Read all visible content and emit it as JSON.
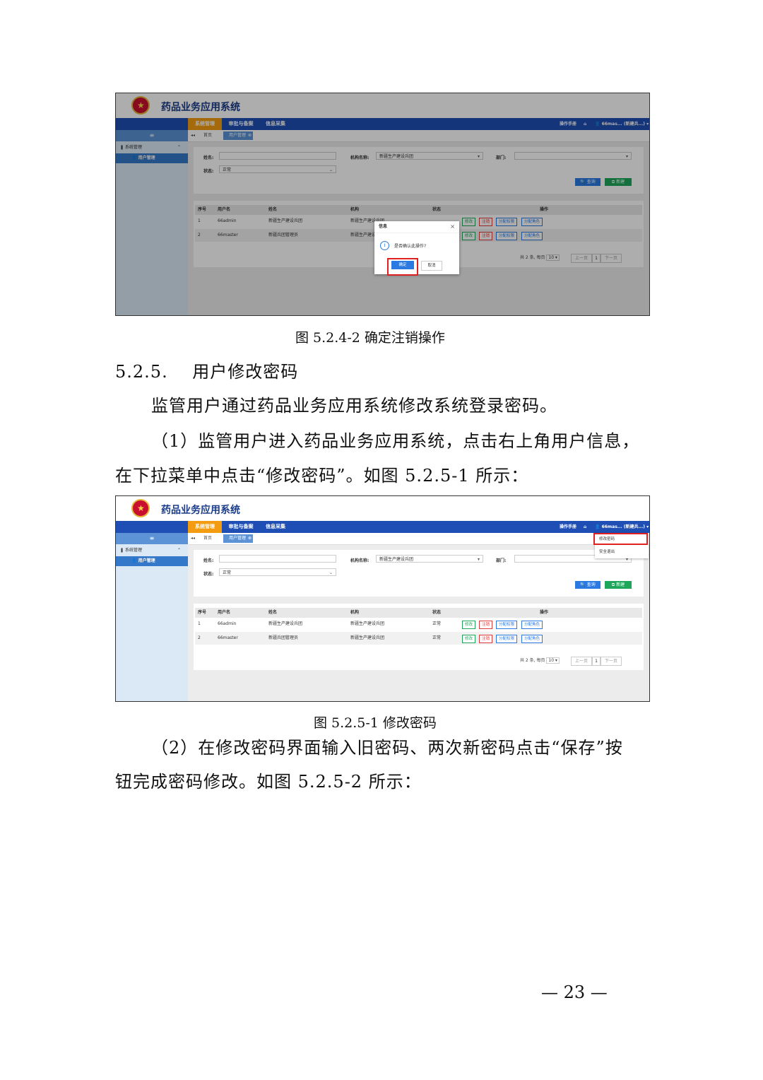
{
  "app": {
    "title": "药品业务应用系统",
    "nav": [
      "系统管理",
      "审批与备案",
      "信息采集"
    ],
    "nav_right": {
      "manual": "操作手册",
      "home_icon": "home-icon",
      "user": "66mas... (新建兵...) ▾"
    },
    "sidebar": {
      "toggle": "≡",
      "group": "系统管理",
      "item": "用户管理"
    },
    "tabs": {
      "home": "首页",
      "active": "用户管理"
    },
    "search": {
      "name_label": "姓名:",
      "org_label": "机构名称:",
      "org_value": "新疆生产建设兵团",
      "dept_label": "部门:",
      "status_label": "状态:",
      "status_value": "正常",
      "query_button": "查询",
      "new_button": "新建"
    },
    "table": {
      "headers": [
        "序号",
        "用户名",
        "姓名",
        "机构",
        "状态",
        "操作"
      ],
      "rows": [
        {
          "no": "1",
          "username": "66admin",
          "name": "新疆生产建设兵团",
          "org": "新疆生产建设兵团",
          "status": "正常"
        },
        {
          "no": "2",
          "username": "66master",
          "name": "新疆兵团管理员",
          "org": "新疆生产建设兵团",
          "status": "正常"
        }
      ],
      "actions": [
        "修改",
        "注销",
        "分配权限",
        "分配角色"
      ],
      "pager": {
        "summary": "共 2 条, 每页",
        "page_size": "10 ▾",
        "prev": "上一页",
        "page": "1",
        "next": "下一页"
      }
    },
    "dialog": {
      "title": "信息",
      "close": "×",
      "message": "是否确认此操作?",
      "ok": "确定",
      "cancel": "取消"
    },
    "dropdown": [
      "修改密码",
      "安全退出"
    ]
  },
  "doc": {
    "caption1": "图 5.2.4-2 确定注销操作",
    "heading": "5.2.5.    用户修改密码",
    "p1": "监管用户通过药品业务应用系统修改系统登录密码。",
    "p2_line1": "（1）监管用户进入药品业务应用系统，点击右上角用户信息，",
    "p2_line2": "在下拉菜单中点击“修改密码”。如图 5.2.5-1 所示：",
    "caption2": "图 5.2.5-1 修改密码",
    "p3_line1": "（2）在修改密码界面输入旧密码、两次新密码点击“保存”按",
    "p3_line2": "钮完成密码修改。如图 5.2.5-2 所示：",
    "page_number": "— 23 —"
  },
  "colors": {
    "nav": "#1f4fb4",
    "nav_active": "#f39c12",
    "highlight": "#e02020",
    "primary": "#2a7ae2",
    "success": "#1ea65a"
  }
}
